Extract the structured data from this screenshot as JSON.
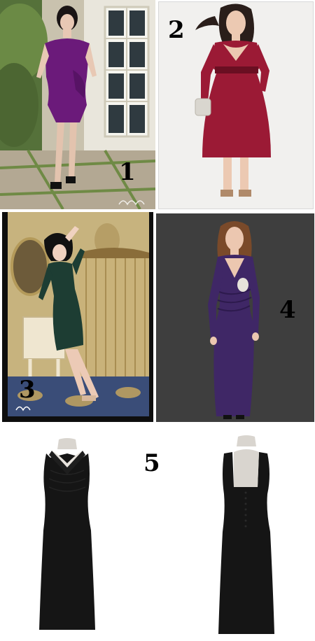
{
  "labels": {
    "panel_1": "1",
    "panel_2": "2",
    "panel_3": "3",
    "panel_4": "4",
    "panel_5": "5"
  },
  "colors": {
    "dress_1": "#6b1a7a",
    "dress_2": "#9b1a35",
    "dress_3": "#1d3d33",
    "dress_4": "#3f2766",
    "dress_5": "#151515",
    "background_4": "#3a3a3a"
  }
}
